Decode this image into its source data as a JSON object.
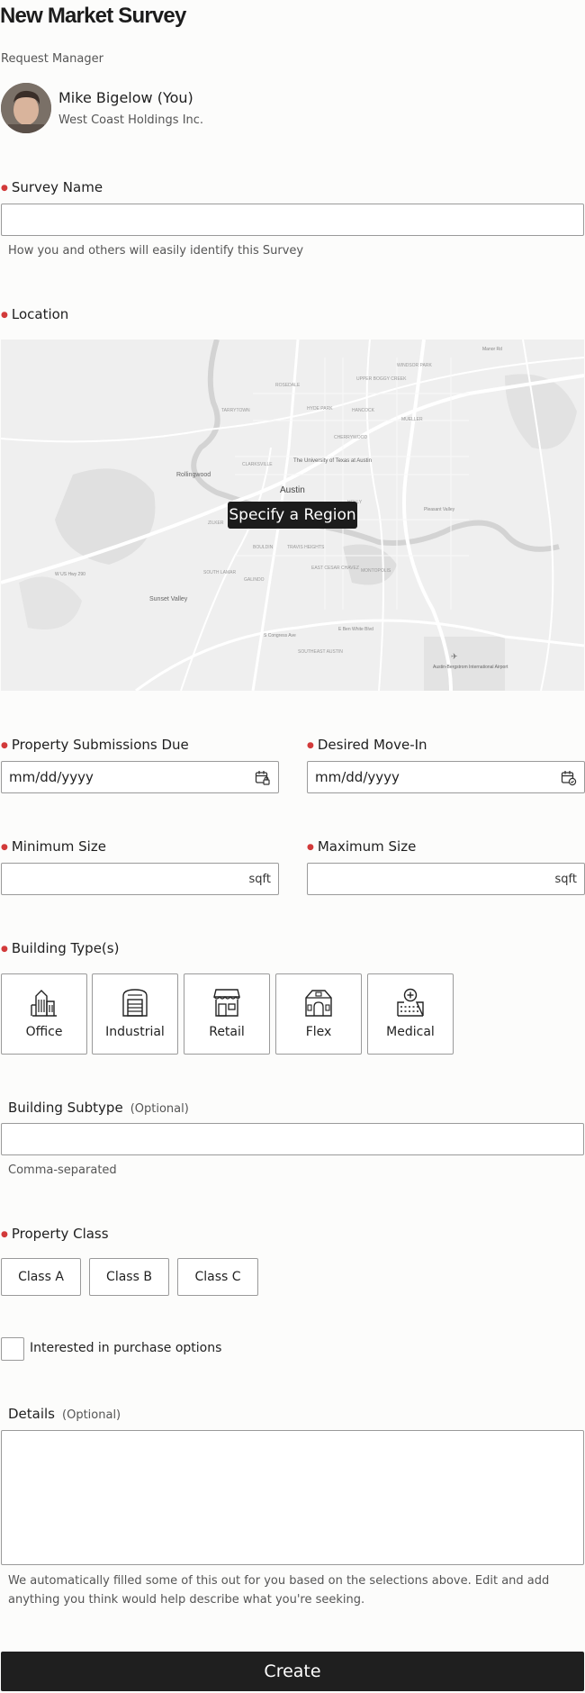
{
  "header": {
    "title": "New Market Survey"
  },
  "request_manager": {
    "heading": "Request Manager",
    "name": "Mike Bigelow (You)",
    "company": "West Coast Holdings Inc."
  },
  "survey_name": {
    "label": "Survey Name",
    "value": "",
    "help": "How you and others will easily identify this Survey"
  },
  "location": {
    "label": "Location",
    "button": "Specify a Region",
    "map_labels": [
      "Austin",
      "The University of Texas at Austin",
      "Rollingwood",
      "Sunset Valley",
      "Austin-Bergstrom International Airport",
      "ROSEDALE",
      "HYDE PARK",
      "CHERRYWOOD",
      "UPPER BOGGY CREEK",
      "WINDSOR PARK",
      "MUELLER",
      "HANCOCK",
      "TARRYTOWN",
      "CLARKSVILLE",
      "ZILKER",
      "BOULDIN",
      "TRAVIS HEIGHTS",
      "SOUTH LAMAR",
      "GALINDO",
      "EAST CESAR CHAVEZ",
      "HOLLY",
      "MONTOPOLIS",
      "SOUTHEAST AUSTIN",
      "W US Hwy 290",
      "E Ben White Blvd",
      "S Congress Ave",
      "Manor Rd",
      "Pleasant Valley"
    ]
  },
  "dates": {
    "submissions_label": "Property Submissions Due",
    "submissions_placeholder": "mm/dd/yyyy",
    "movein_label": "Desired Move-In",
    "movein_placeholder": "mm/dd/yyyy"
  },
  "size": {
    "min_label": "Minimum Size",
    "max_label": "Maximum Size",
    "unit": "sqft"
  },
  "building_types": {
    "label": "Building Type(s)",
    "items": [
      {
        "label": "Office",
        "icon": "office-building-icon"
      },
      {
        "label": "Industrial",
        "icon": "warehouse-icon"
      },
      {
        "label": "Retail",
        "icon": "storefront-icon"
      },
      {
        "label": "Flex",
        "icon": "flex-building-icon"
      },
      {
        "label": "Medical",
        "icon": "medical-building-icon"
      }
    ]
  },
  "subtype": {
    "label": "Building Subtype",
    "optional": "(Optional)",
    "help": "Comma-separated"
  },
  "property_class": {
    "label": "Property Class",
    "options": [
      "Class A",
      "Class B",
      "Class C"
    ]
  },
  "purchase": {
    "label": "Interested in purchase options",
    "checked": false
  },
  "details": {
    "label": "Details",
    "optional": "(Optional)",
    "help": "We automatically filled some of this out for you based on the selections above. Edit and add anything you think would help describe what you're seeking."
  },
  "actions": {
    "create": "Create"
  },
  "colors": {
    "required": "#d23a3a",
    "primary_button": "#1f1f1f",
    "border": "#9a9a9a"
  }
}
